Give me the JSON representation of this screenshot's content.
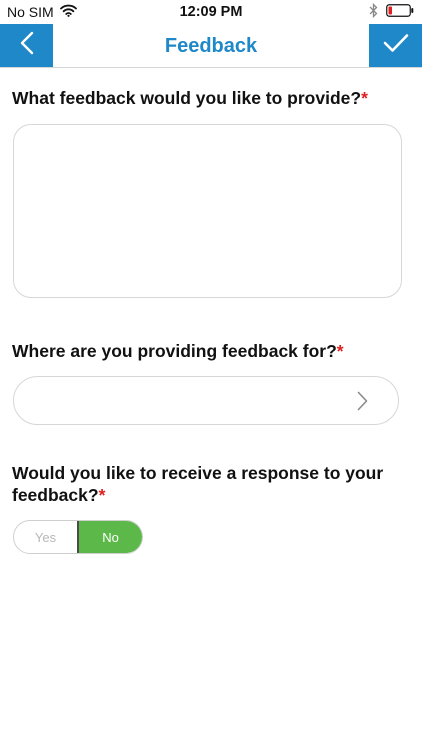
{
  "status_bar": {
    "carrier": "No SIM",
    "time": "12:09 PM",
    "wifi_icon": "wifi-icon",
    "bluetooth_icon": "bluetooth-icon",
    "battery_icon": "battery-low-icon",
    "battery_color": "#e02020"
  },
  "nav": {
    "title": "Feedback",
    "back_icon": "chevron-left-icon",
    "done_icon": "checkmark-icon",
    "accent_color": "#1e88c8"
  },
  "form": {
    "feedback_question": "What feedback would you like to provide?",
    "feedback_value": "",
    "location_question": "Where are you providing feedback for?",
    "location_value": "",
    "location_chevron_icon": "chevron-right-icon",
    "response_question_line1": "Would you like to receive a response to your",
    "response_question_line2": "feedback?",
    "required_marker": "*",
    "required_color": "#e02020",
    "toggle": {
      "yes_label": "Yes",
      "no_label": "No",
      "selected": "No",
      "selected_color": "#5cb848"
    }
  }
}
